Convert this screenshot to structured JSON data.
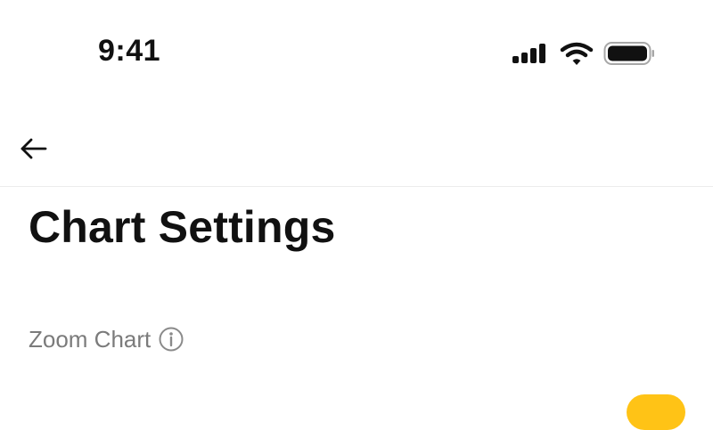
{
  "status_bar": {
    "time": "9:41",
    "signal_icon": "cellular-signal-icon",
    "wifi_icon": "wifi-icon",
    "battery_icon": "battery-icon"
  },
  "nav": {
    "back_icon": "back-arrow-icon"
  },
  "page": {
    "title": "Chart Settings"
  },
  "sections": [
    {
      "label": "Zoom Chart",
      "info_icon": "info-icon"
    }
  ],
  "colors": {
    "accent": "#FFC316",
    "label_gray": "#7B7B7B",
    "text": "#111111"
  }
}
